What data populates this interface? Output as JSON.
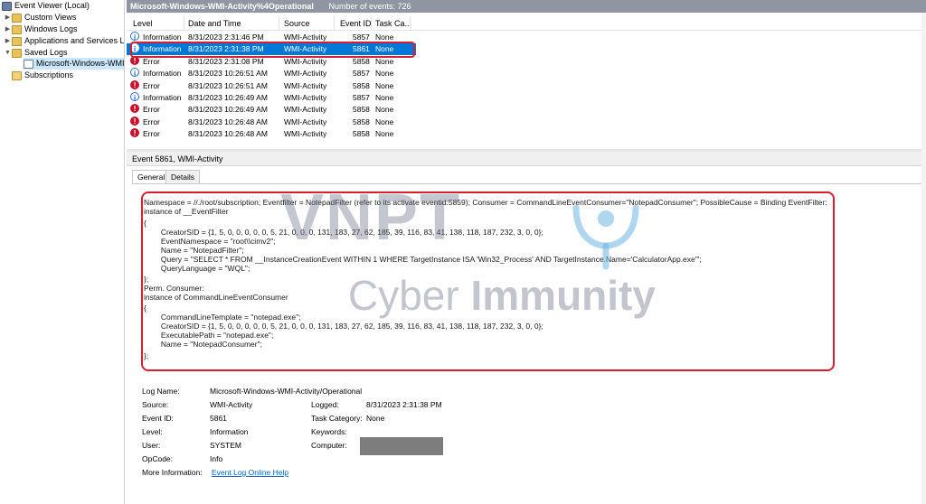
{
  "tree": {
    "root": "Event Viewer (Local)",
    "items": [
      {
        "label": "Custom Views"
      },
      {
        "label": "Windows Logs"
      },
      {
        "label": "Applications and Services Lo"
      },
      {
        "label": "Saved Logs"
      },
      {
        "label": "Microsoft-Windows-WMI"
      },
      {
        "label": "Subscriptions"
      }
    ]
  },
  "header": {
    "title": "Microsoft-Windows-WMI-Activity%4Operational",
    "count": "Number of events: 726"
  },
  "list": {
    "columns": [
      "Level",
      "Date and Time",
      "Source",
      "Event ID",
      "Task Ca..."
    ],
    "rows": [
      {
        "level": "Information",
        "date": "8/31/2023 2:31:46 PM",
        "source": "WMI-Activity",
        "id": "5857",
        "task": "None"
      },
      {
        "level": "Information",
        "date": "8/31/2023 2:31:38 PM",
        "source": "WMI-Activity",
        "id": "5861",
        "task": "None"
      },
      {
        "level": "Error",
        "date": "8/31/2023 2:31:08 PM",
        "source": "WMI-Activity",
        "id": "5858",
        "task": "None"
      },
      {
        "level": "Information",
        "date": "8/31/2023 10:26:51 AM",
        "source": "WMI-Activity",
        "id": "5857",
        "task": "None"
      },
      {
        "level": "Error",
        "date": "8/31/2023 10:26:51 AM",
        "source": "WMI-Activity",
        "id": "5858",
        "task": "None"
      },
      {
        "level": "Information",
        "date": "8/31/2023 10:26:49 AM",
        "source": "WMI-Activity",
        "id": "5857",
        "task": "None"
      },
      {
        "level": "Error",
        "date": "8/31/2023 10:26:49 AM",
        "source": "WMI-Activity",
        "id": "5858",
        "task": "None"
      },
      {
        "level": "Error",
        "date": "8/31/2023 10:26:48 AM",
        "source": "WMI-Activity",
        "id": "5858",
        "task": "None"
      },
      {
        "level": "Error",
        "date": "8/31/2023 10:26:48 AM",
        "source": "WMI-Activity",
        "id": "5858",
        "task": "None"
      }
    ]
  },
  "details": {
    "title": "Event 5861, WMI-Activity",
    "tabs": [
      "General",
      "Details"
    ],
    "message": [
      "Namespace = //./root/subscription; Eventfilter = NotepadFilter (refer to its activate eventid:5859); Consumer = CommandLineEventConsumer=\"NotepadConsumer\"; PossibleCause = Binding EventFilter:",
      "instance of __EventFilter",
      "{",
      "        CreatorSID = {1, 5, 0, 0, 0, 0, 0, 5, 21, 0, 0, 0, 131, 183, 27, 62, 185, 39, 116, 83, 41, 138, 118, 187, 232, 3, 0, 0};",
      "        EventNamespace = \"root\\\\cimv2\";",
      "        Name = \"NotepadFilter\";",
      "        Query = \"SELECT * FROM __InstanceCreationEvent WITHIN 1 WHERE TargetInstance ISA 'Win32_Process' AND TargetInstance.Name='CalculatorApp.exe'\";",
      "        QueryLanguage = \"WQL\";",
      "};",
      "Perm. Consumer:",
      "instance of CommandLineEventConsumer",
      "{",
      "        CommandLineTemplate = \"notepad.exe\";",
      "        CreatorSID = {1, 5, 0, 0, 0, 0, 0, 5, 21, 0, 0, 0, 131, 183, 27, 62, 185, 39, 116, 83, 41, 138, 118, 187, 232, 3, 0, 0};",
      "        ExecutablePath = \"notepad.exe\";",
      "        Name = \"NotepadConsumer\";",
      "};"
    ],
    "props": {
      "log_name_label": "Log Name:",
      "log_name": "Microsoft-Windows-WMI-Activity/Operational",
      "source_label": "Source:",
      "source": "WMI-Activity",
      "logged_label": "Logged:",
      "logged": "8/31/2023 2:31:38 PM",
      "event_id_label": "Event ID:",
      "event_id": "5861",
      "task_label": "Task Category:",
      "task": "None",
      "level_label": "Level:",
      "level": "Information",
      "keywords_label": "Keywords:",
      "user_label": "User:",
      "user": "SYSTEM",
      "computer_label": "Computer:",
      "opcode_label": "OpCode:",
      "opcode": "Info",
      "more_label": "More Information:",
      "more_link": "Event Log Online Help"
    }
  },
  "watermark": {
    "brand": "VNPT",
    "tagline_light": "Cyber ",
    "tagline_bold": "Immunity"
  },
  "colors": {
    "accent": "#0078d7",
    "highlight": "#d71f2e",
    "error": "#c8102e",
    "header": "#8f96a1"
  }
}
